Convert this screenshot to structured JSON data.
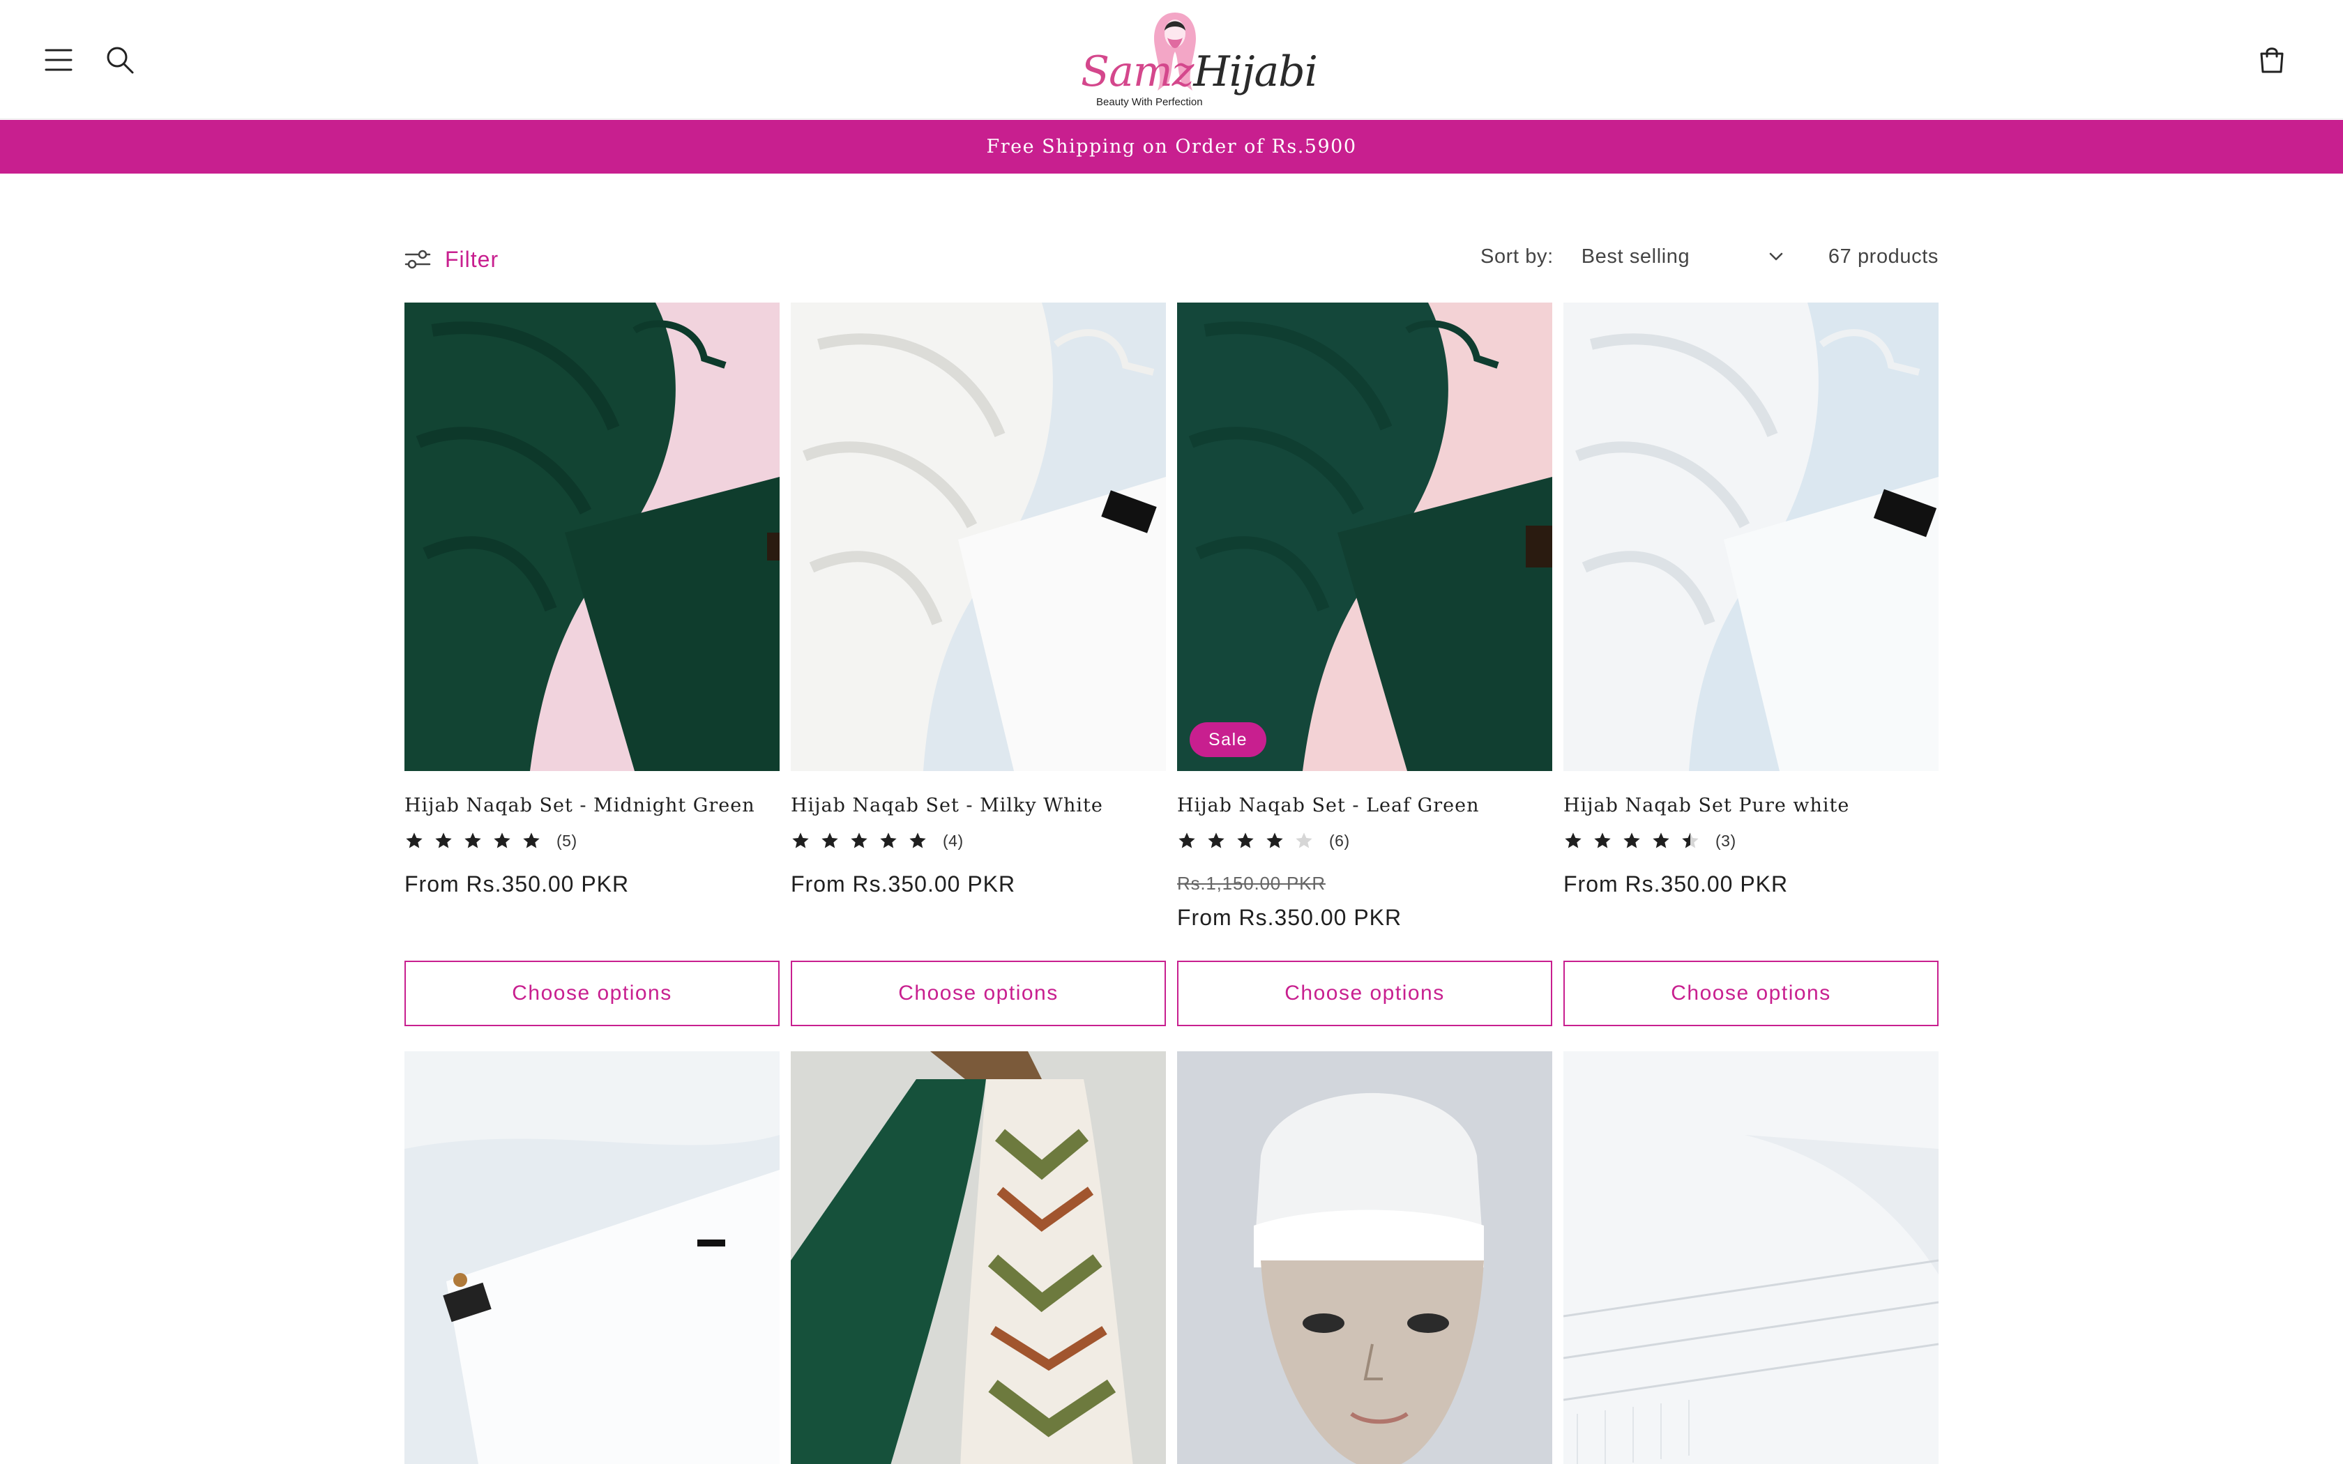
{
  "header": {
    "logo_primary": "Samz",
    "logo_secondary": "Hijabi",
    "logo_tagline": "Beauty With Perfection",
    "icons": [
      "menu-icon",
      "search-icon",
      "cart-icon"
    ]
  },
  "announcement": "Free Shipping on Order of Rs.5900",
  "toolbar": {
    "filter_label": "Filter",
    "sort_label": "Sort by:",
    "sort_value": "Best selling",
    "product_count": "67 products"
  },
  "colors": {
    "accent": "#c81f8f",
    "text": "#1f1f1f",
    "muted": "#666666"
  },
  "products": [
    {
      "title": "Hijab Naqab Set - Midnight Green",
      "rating": 5,
      "review_count": "(5)",
      "price": "From Rs.350.00 PKR",
      "button": "Choose options"
    },
    {
      "title": "Hijab Naqab Set - Milky White",
      "rating": 5,
      "review_count": "(4)",
      "price": "From Rs.350.00 PKR",
      "button": "Choose options"
    },
    {
      "title": "Hijab Naqab Set - Leaf Green",
      "rating": 4,
      "review_count": "(6)",
      "badge": "Sale",
      "compare_price": "Rs.1,150.00 PKR",
      "price": "From Rs.350.00 PKR",
      "button": "Choose options"
    },
    {
      "title": "Hijab Naqab Set Pure white",
      "rating": 4.5,
      "review_count": "(3)",
      "price": "From Rs.350.00 PKR",
      "button": "Choose options"
    }
  ],
  "second_row": [
    {
      "image": "white-naqab-set"
    },
    {
      "image": "green-printed-scarf"
    },
    {
      "image": "white-cap-on-mannequin"
    },
    {
      "image": "white-lace-hijab"
    }
  ]
}
